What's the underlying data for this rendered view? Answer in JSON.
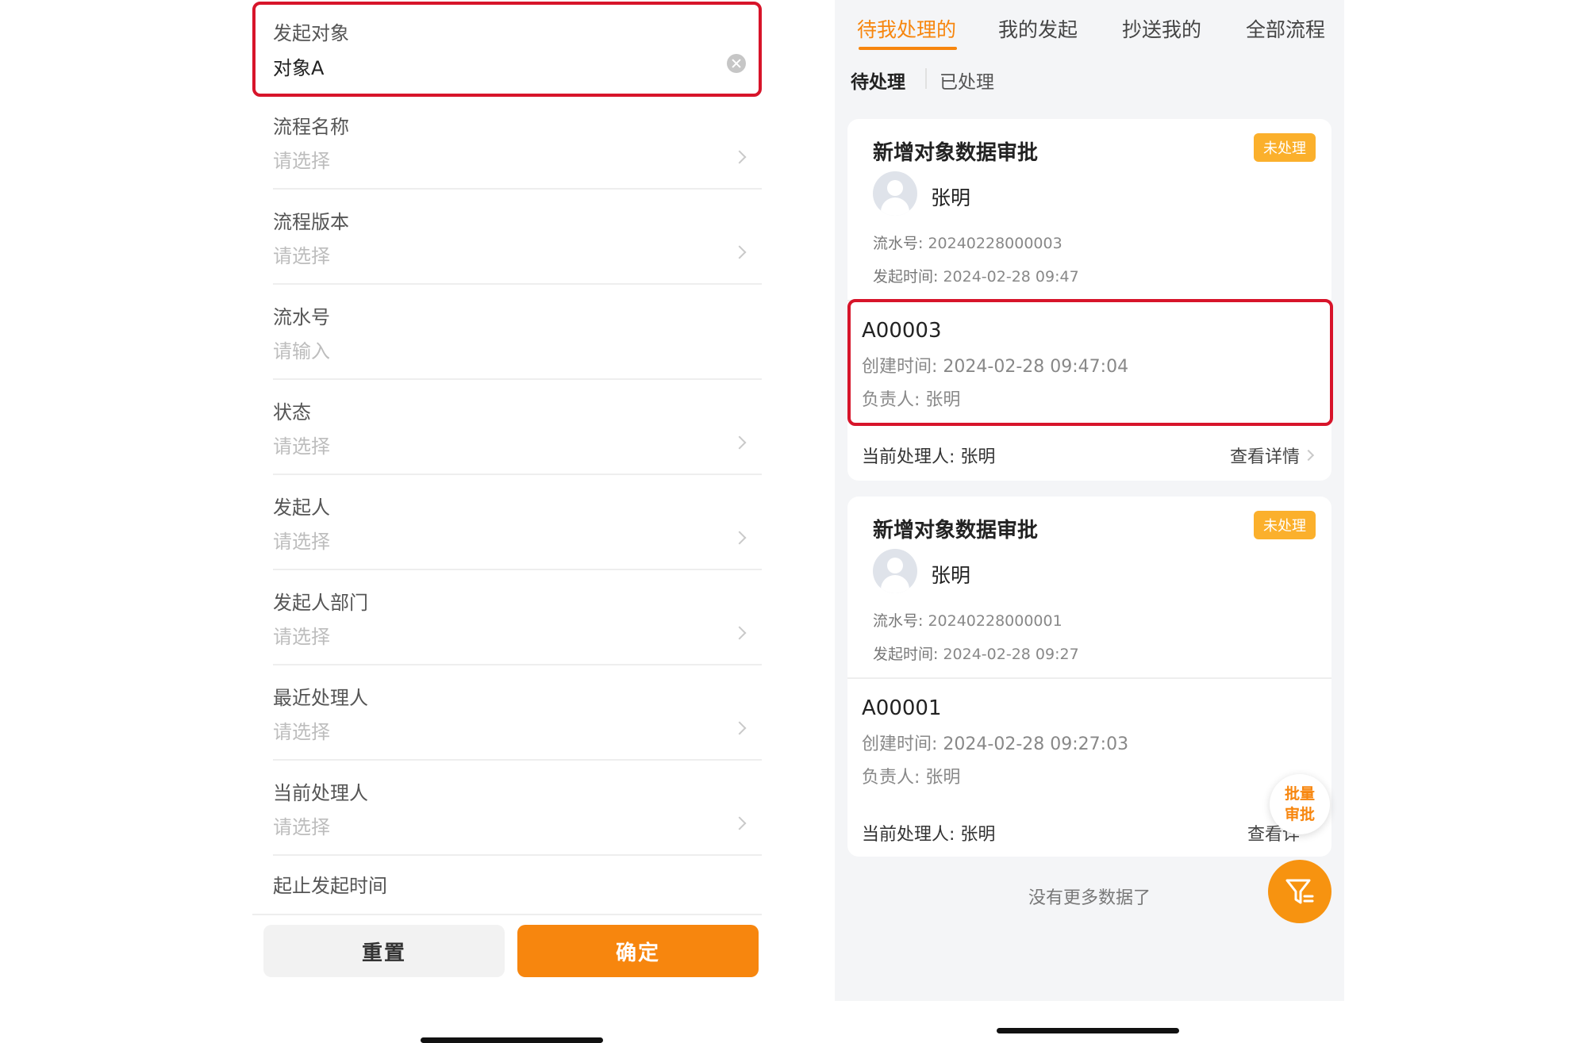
{
  "left": {
    "initiator_object": {
      "label": "发起对象",
      "value": "对象A"
    },
    "fields": [
      {
        "label": "流程名称",
        "placeholder": "请选择",
        "chevron": true
      },
      {
        "label": "流程版本",
        "placeholder": "请选择",
        "chevron": true
      },
      {
        "label": "流水号",
        "placeholder": "请输入",
        "chevron": false
      },
      {
        "label": "状态",
        "placeholder": "请选择",
        "chevron": true
      },
      {
        "label": "发起人",
        "placeholder": "请选择",
        "chevron": true
      },
      {
        "label": "发起人部门",
        "placeholder": "请选择",
        "chevron": true
      },
      {
        "label": "最近处理人",
        "placeholder": "请选择",
        "chevron": true
      },
      {
        "label": "当前处理人",
        "placeholder": "请选择",
        "chevron": true
      }
    ],
    "time_range_label": "起止发起时间",
    "buttons": {
      "reset": "重置",
      "confirm": "确定"
    }
  },
  "right": {
    "tabs": [
      "待我处理的",
      "我的发起",
      "抄送我的",
      "全部流程"
    ],
    "active_tab": 0,
    "subtabs": [
      "待处理",
      "已处理"
    ],
    "active_subtab": 0,
    "cards": [
      {
        "title": "新增对象数据审批",
        "status": "未处理",
        "user": "张明",
        "serial_label": "流水号:",
        "serial": "20240228000003",
        "start_time_label": "发起时间:",
        "start_time": "2024-02-28 09:47",
        "object_code": "A00003",
        "created_label": "创建时间:",
        "created": "2024-02-28 09:47:04",
        "owner_label": "负责人:",
        "owner": "张明",
        "handler_label": "当前处理人:",
        "handler": "张明",
        "detail_label": "查看详情"
      },
      {
        "title": "新增对象数据审批",
        "status": "未处理",
        "user": "张明",
        "serial_label": "流水号:",
        "serial": "20240228000001",
        "start_time_label": "发起时间:",
        "start_time": "2024-02-28 09:27",
        "object_code": "A00001",
        "created_label": "创建时间:",
        "created": "2024-02-28 09:27:03",
        "owner_label": "负责人:",
        "owner": "张明",
        "handler_label": "当前处理人:",
        "handler": "张明",
        "detail_label": "查看详"
      }
    ],
    "no_more": "没有更多数据了",
    "batch_approve": [
      "批量",
      "审批"
    ]
  },
  "colors": {
    "accent": "#f7860e",
    "highlight": "#d7142a",
    "badge": "#fbb02c"
  }
}
